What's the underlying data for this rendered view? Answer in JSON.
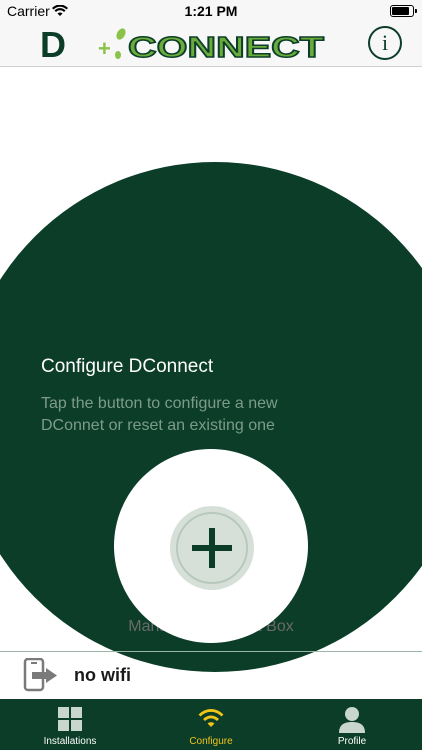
{
  "status_bar": {
    "carrier": "Carrier",
    "time": "1:21 PM"
  },
  "header": {
    "logo_letter": "D",
    "logo_word": "CONNECT",
    "info_label": "i"
  },
  "main": {
    "title": "Configure DConnect",
    "description": "Tap the button to configure a new DConnet or reset an existing one",
    "manage_text": "Manage DConnect Box",
    "connection_status": "no wifi"
  },
  "tabs": [
    {
      "label": "Installations",
      "icon": "grid-icon",
      "active": false
    },
    {
      "label": "Configure",
      "icon": "wifi-icon",
      "active": true
    },
    {
      "label": "Profile",
      "icon": "person-icon",
      "active": false
    }
  ],
  "colors": {
    "brand_dark": "#0b3d28",
    "brand_light": "#8bc34a",
    "active_tab": "#f0c419"
  }
}
